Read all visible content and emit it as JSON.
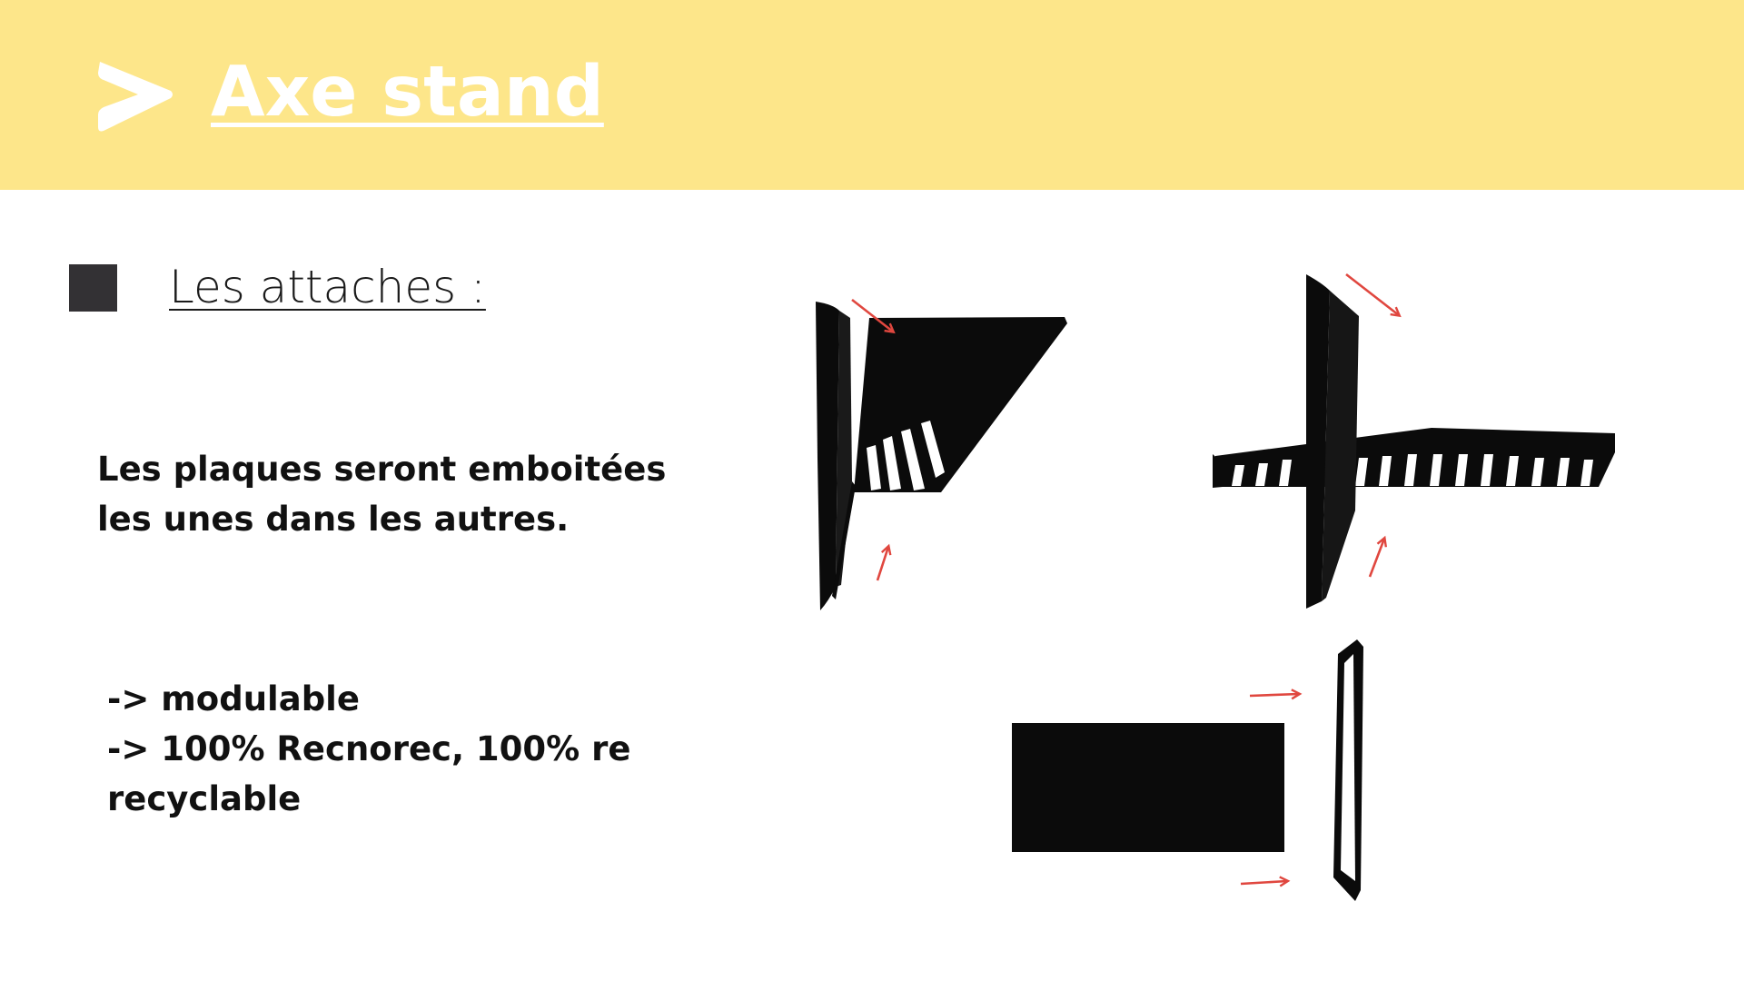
{
  "slide": {
    "title": "Axe stand",
    "logo_icon": "chevron-arrow-logo-icon",
    "section_heading": "Les attaches :",
    "paragraph_lines": [
      "Les plaques seront emboitées",
      "les unes dans les autres."
    ],
    "points_lines": [
      "-> modulable",
      "-> 100% Recnorec, 100% re",
      "recyclable"
    ]
  },
  "illustration": {
    "description_icons": [
      "slotted-panel-assembly-icon",
      "slotted-panel-assembly-icon",
      "flat-panel-insert-icon"
    ]
  },
  "colors": {
    "header_band": "#fde68a",
    "title": "#ffffff",
    "bullet": "#333134",
    "text": "#111111",
    "arrow": "#e0473f"
  }
}
